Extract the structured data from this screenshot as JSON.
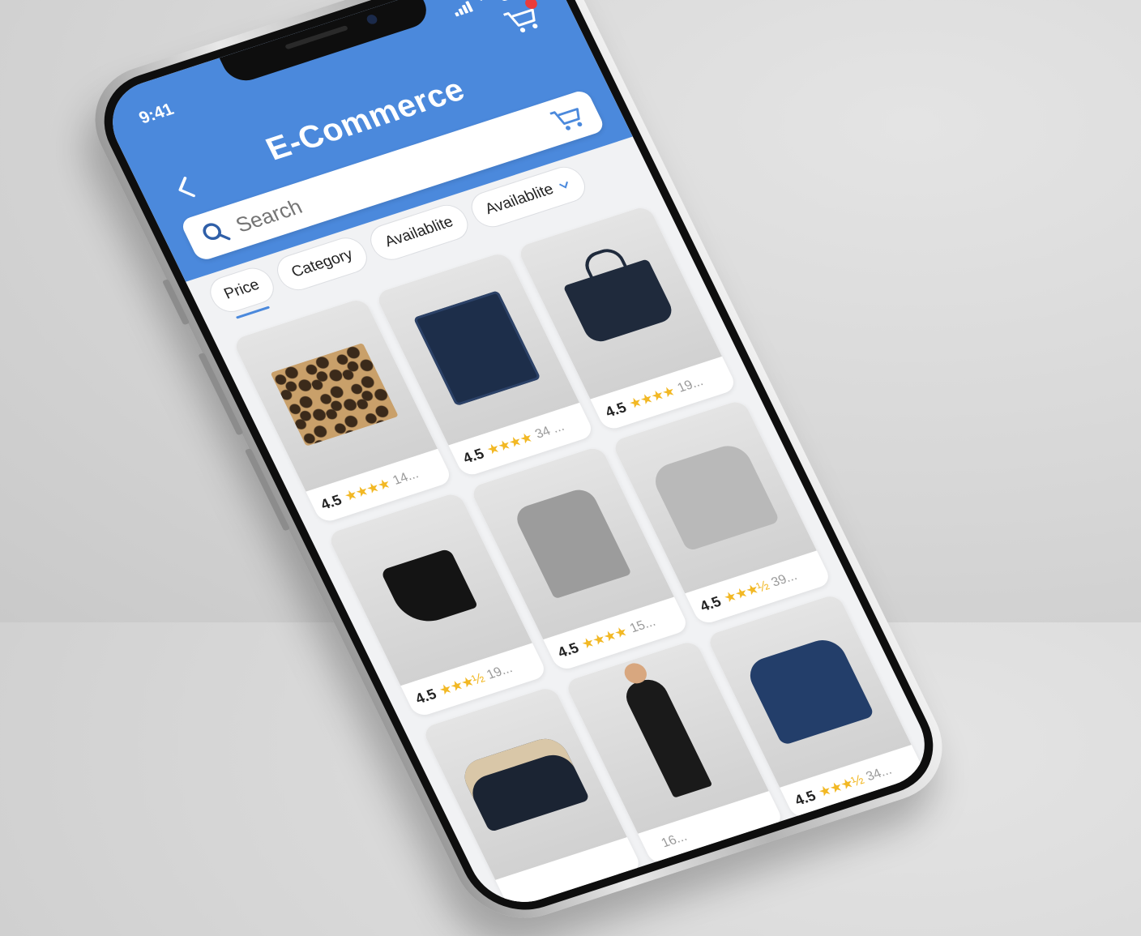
{
  "status_bar": {
    "time": "9:41"
  },
  "header": {
    "title": "E-Commerce",
    "back_icon": "chevron-left-icon",
    "cart_icon": "cart-icon"
  },
  "search": {
    "placeholder": "Search",
    "search_icon": "search-icon",
    "cart_icon": "cart-icon"
  },
  "filters": [
    {
      "label": "Price",
      "active": true
    },
    {
      "label": "Category",
      "active": false
    },
    {
      "label": "Availablite",
      "active": false
    },
    {
      "label": "Availablite",
      "active": false,
      "dropdown": true
    }
  ],
  "products": [
    {
      "name": "leopard-print-item",
      "rating": "4.5",
      "stars": "★★★★",
      "count": "14..."
    },
    {
      "name": "denim-pocket-item",
      "rating": "4.5",
      "stars": "★★★★",
      "count": "34 ..."
    },
    {
      "name": "dark-tote-bag",
      "rating": "4.5",
      "stars": "★★★★",
      "count": "19..."
    },
    {
      "name": "black-ankle-boot",
      "rating": "4.5",
      "stars": "★★★½",
      "count": "19..."
    },
    {
      "name": "grey-wool-coat",
      "rating": "4.5",
      "stars": "★★★★",
      "count": "15..."
    },
    {
      "name": "grey-hoodie",
      "rating": "4.5",
      "stars": "★★★½",
      "count": "39..."
    },
    {
      "name": "shearling-jacket",
      "rating": "",
      "stars": "",
      "count": ""
    },
    {
      "name": "leather-jacket-look",
      "rating": "",
      "stars": "",
      "count": "16..."
    },
    {
      "name": "navy-jacket",
      "rating": "4.5",
      "stars": "★★★½",
      "count": "34..."
    }
  ],
  "colors": {
    "primary": "#4b89dc",
    "star": "#f2b824",
    "badge": "#ea3b3b"
  }
}
